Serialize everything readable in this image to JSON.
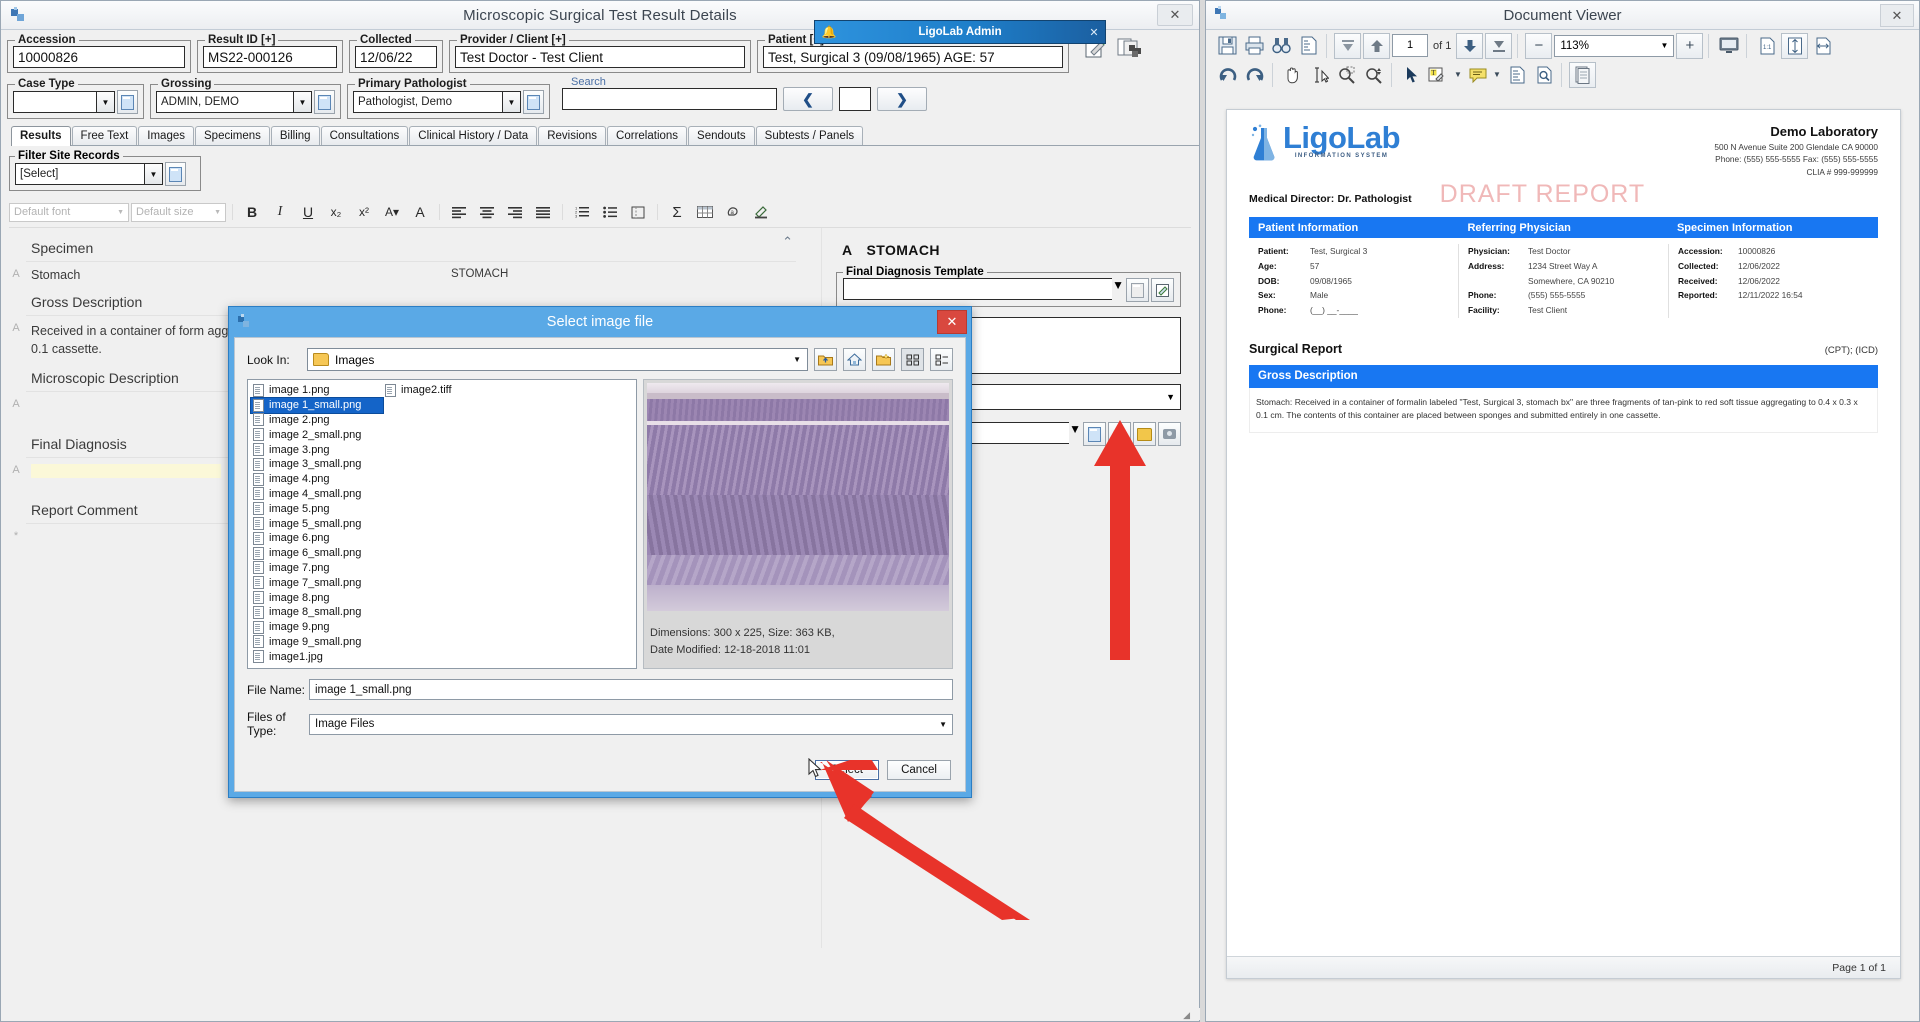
{
  "left_window": {
    "title": "Microscopic Surgical Test Result Details",
    "close_label": "✕",
    "fields": [
      {
        "legend": "Accession",
        "value": "10000826"
      },
      {
        "legend": "Result ID [+]",
        "value": "MS22-000126"
      },
      {
        "legend": "Collected",
        "value": "12/06/22"
      },
      {
        "legend": "Provider / Client [+]",
        "value": "Test Doctor - Test Client"
      },
      {
        "legend": "Patient [+]",
        "value": "Test, Surgical 3 (09/08/1965) AGE: 57"
      }
    ],
    "selectors": [
      {
        "legend": "Case Type",
        "value": ""
      },
      {
        "legend": "Grossing",
        "value": "ADMIN, DEMO"
      },
      {
        "legend": "Primary Pathologist",
        "value": "Pathologist, Demo"
      }
    ],
    "search": {
      "label": "Search",
      "value": "",
      "prev": "❮",
      "next": "❯",
      "mid": ""
    },
    "tabs": [
      {
        "label": "Results",
        "active": true
      },
      {
        "label": "Free Text",
        "active": false
      },
      {
        "label": "Images",
        "active": false
      },
      {
        "label": "Specimens",
        "active": false
      },
      {
        "label": "Billing",
        "active": false
      },
      {
        "label": "Consultations",
        "active": false
      },
      {
        "label": "Clinical History / Data",
        "active": false
      },
      {
        "label": "Revisions",
        "active": false
      },
      {
        "label": "Correlations",
        "active": false
      },
      {
        "label": "Sendouts",
        "active": false
      },
      {
        "label": "Subtests / Panels",
        "active": false
      }
    ],
    "filter": {
      "legend": "Filter Site Records",
      "value": "[Select]"
    },
    "editor_toolbar": {
      "font_placeholder": "Default font",
      "size_placeholder": "Default size",
      "buttons": [
        "B",
        "I",
        "U",
        "x₂",
        "x²",
        "A▾",
        "A",
        "≡",
        "≡",
        "≡",
        "≡",
        "1.",
        "•",
        "▤",
        "Σ",
        "▦",
        "✇",
        "✎"
      ]
    },
    "sections": [
      {
        "title": "Specimen",
        "letter": "A",
        "text": "Stomach",
        "right": "STOMACH"
      },
      {
        "title": "Gross Description",
        "letter": "A",
        "text": "Received in a container of form aggregating to 0.4 x 0.3 x 0.1 cassette.",
        "right": ""
      },
      {
        "title": "Microscopic Description",
        "letter": "A",
        "text": "",
        "right": ""
      },
      {
        "title": "Final Diagnosis",
        "letter": "A",
        "text": "",
        "right": ""
      },
      {
        "title": "Report Comment",
        "letter": "*",
        "text": "",
        "right": ""
      }
    ],
    "right_panel": {
      "letter": "A",
      "heading": "STOMACH",
      "final_diag_template_legend": "Final Diagnosis Template",
      "final_diag_template_value": ""
    }
  },
  "ligolab_admin": {
    "title": "LigoLab Admin",
    "bell_icon": "bell-icon",
    "close": "✕"
  },
  "file_dialog": {
    "title": "Select image file",
    "close": "✕",
    "look_in_label": "Look In:",
    "look_in_value": "Images",
    "nav_icons": [
      "up-folder-icon",
      "home-icon",
      "new-folder-icon",
      "tiles-view-icon",
      "details-view-icon"
    ],
    "files_col1": [
      "image 1.png",
      "image 1_small.png",
      "image 2.png",
      "image 2_small.png",
      "image 3.png",
      "image 3_small.png",
      "image 4.png",
      "image 4_small.png",
      "image 5.png",
      "image 5_small.png",
      "image 6.png",
      "image 6_small.png",
      "image 7.png",
      "image 7_small.png",
      "image 8.png",
      "image 8_small.png"
    ],
    "files_col2": [
      "image 9.png",
      "image 9_small.png",
      "image1.jpg",
      "image2.tiff"
    ],
    "selected_file": "image 1_small.png",
    "preview_dimensions": "Dimensions: 300 x 225,  Size: 363 KB,",
    "preview_modified": "Date Modified: 12-18-2018 11:01",
    "file_name_label": "File Name:",
    "file_name_value": "image 1_small.png",
    "files_of_type_label": "Files of Type:",
    "files_of_type_value": "Image Files",
    "select_button": "Select",
    "cancel_button": "Cancel"
  },
  "doc_viewer": {
    "title": "Document Viewer",
    "close": "✕",
    "toolbar": {
      "page_value": "1",
      "of_pages": "of 1",
      "zoom_value": "113%",
      "minus": "−",
      "plus": "+"
    },
    "report": {
      "logo_text": "LigoLab",
      "logo_sub": "INFORMATION SYSTEM",
      "lab_name": "Demo Laboratory",
      "lab_address": "500 N Avenue Suite 200  Glendale  CA 90000",
      "lab_phone": "Phone:  (555) 555-5555    Fax: (555) 555-5555",
      "lab_clia": "CLIA # 999-999999",
      "medical_director_label": "Medical Director:",
      "medical_director_value": "Dr. Pathologist",
      "draft_watermark": "DRAFT REPORT",
      "headers": [
        "Patient Information",
        "Referring Physician",
        "Specimen Information"
      ],
      "patient": [
        {
          "k": "Patient:",
          "v": "Test, Surgical 3"
        },
        {
          "k": "Age:",
          "v": "57"
        },
        {
          "k": "DOB:",
          "v": "09/08/1965"
        },
        {
          "k": "Sex:",
          "v": "Male"
        },
        {
          "k": "Phone:",
          "v": "(__) __-____"
        }
      ],
      "physician": [
        {
          "k": "Physician:",
          "v": "Test Doctor"
        },
        {
          "k": "Address:",
          "v": "1234 Street Way A"
        },
        {
          "k": "",
          "v": "Somewhere, CA 90210"
        },
        {
          "k": "Phone:",
          "v": "(555) 555-5555"
        },
        {
          "k": "Facility:",
          "v": "Test Client"
        }
      ],
      "specimen": [
        {
          "k": "Accession:",
          "v": "10000826"
        },
        {
          "k": "Collected:",
          "v": "12/06/2022"
        },
        {
          "k": "Received:",
          "v": "12/06/2022"
        },
        {
          "k": "Reported:",
          "v": "12/11/2022 16:54"
        }
      ],
      "surgical_report_title": "Surgical Report",
      "surgical_report_codes": "(CPT);  (ICD)",
      "gross_description_header": "Gross Description",
      "gross_description_body": "Stomach:  Received in a container of formalin labeled \"Test, Surgical 3, stomach bx\" are three fragments of tan-pink to red soft tissue aggregating to 0.4 x 0.3 x 0.1 cm. The contents of this container are placed between sponges and submitted entirely in one cassette.",
      "page_footer": "Page 1 of 1"
    }
  },
  "colors": {
    "accent_blue": "#1877f2",
    "dialog_blue": "#5aa9e6",
    "arrow_red": "#e8332a",
    "selection_blue": "#1464c8"
  }
}
